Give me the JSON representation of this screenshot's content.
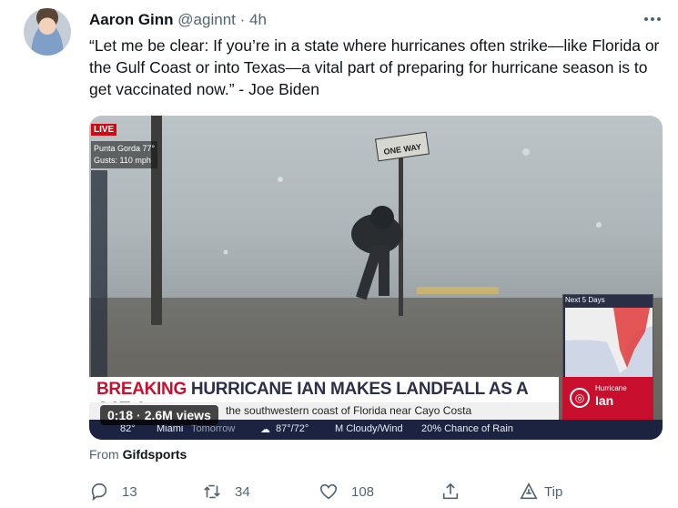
{
  "author": {
    "name": "Aaron Ginn",
    "handle": "@aginnt",
    "separator": "·",
    "time": "4h"
  },
  "tweet_text": "“Let me be clear: If you’re in a state where hurricanes often strike—like Florida or the Gulf Coast or into Texas—a vital part of preparing for hurricane season is to get vaccinated now.” - Joe Biden",
  "media": {
    "live_badge": "LIVE",
    "location": "Punta Gorda  77°",
    "gusts": "Gusts:  110 mph",
    "street_sign": "ONE WAY",
    "map_title": "Next 5 Days",
    "breaking_label": "BREAKING",
    "headline": "HURRICANE IAN MAKES LANDFALL AS A CAT 4",
    "subheadline": "the southwestern coast of Florida near Cayo Costa",
    "hurricane_label": "Hurricane",
    "hurricane_name": "Ian",
    "weather": {
      "temp": "82°",
      "city": "Miami",
      "day": "Tomorrow",
      "hi_lo": "87°/72°",
      "condition": "M Cloudy/Wind",
      "chance": "20% Chance of Rain"
    },
    "duration": "0:18",
    "views_separator": "·",
    "views": "2.6M views"
  },
  "source": {
    "prefix": "From",
    "name": "Gifdsports"
  },
  "actions": {
    "reply_count": "13",
    "retweet_count": "34",
    "like_count": "108",
    "tip_label": "Tip"
  },
  "colors": {
    "breaking_red": "#c8102e",
    "text_primary": "#0f1419",
    "text_secondary": "#536471"
  }
}
